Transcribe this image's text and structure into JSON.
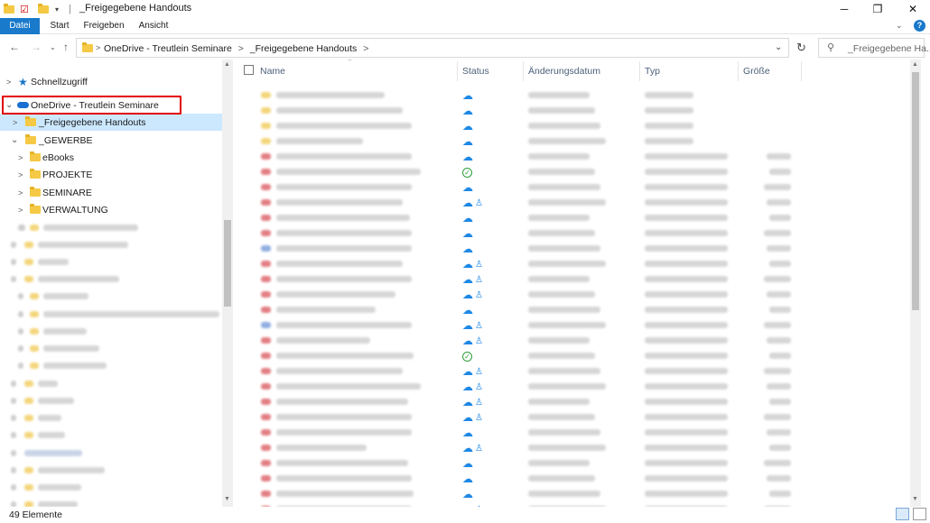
{
  "window": {
    "title": "_Freigegebene Handouts",
    "controls": [
      "─",
      "❐",
      "✕"
    ]
  },
  "ribbon": {
    "tabs": [
      "Datei",
      "Start",
      "Freigeben",
      "Ansicht"
    ]
  },
  "address": {
    "crumbs": [
      "OneDrive - Treutlein Seminare",
      "_Freigegebene Handouts"
    ],
    "separator": ">"
  },
  "search": {
    "placeholder": "_Freigegebene Ha..."
  },
  "nav": {
    "quick_access": "Schnellzugriff",
    "onedrive": "OneDrive - Treutlein Seminare",
    "selected": "_Freigegebene Handouts",
    "gewerbe": "_GEWERBE",
    "sub": [
      "eBooks",
      "PROJEKTE",
      "SEMINARE",
      "VERWALTUNG"
    ]
  },
  "columns": {
    "name": "Name",
    "status": "Status",
    "date": "Änderungsdatum",
    "type": "Typ",
    "size": "Größe"
  },
  "status_bar": {
    "count": "49 Elemente"
  },
  "colors": {
    "accent": "#1979ca",
    "selection": "#cce8ff",
    "highlight": "#e00000",
    "cloud": "#1e88e5",
    "synced": "#2e9e3b"
  }
}
